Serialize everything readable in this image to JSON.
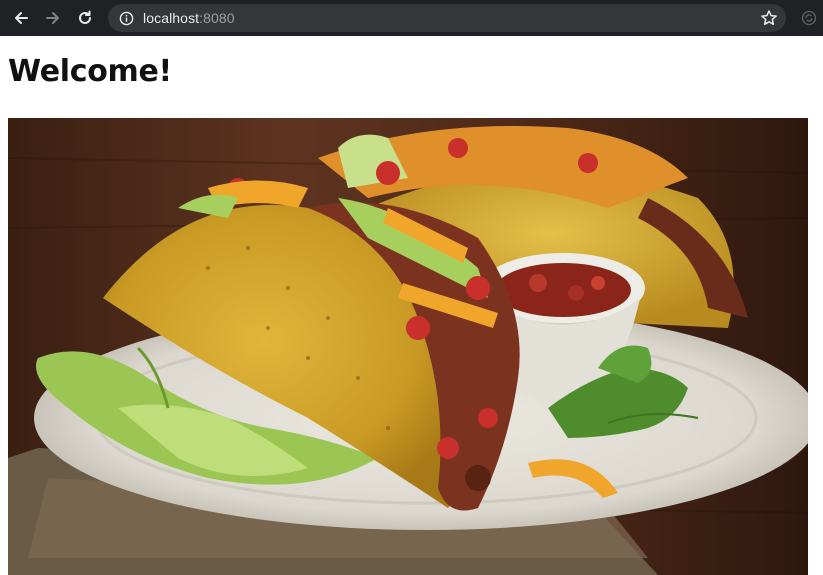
{
  "browser": {
    "url_host": "localhost",
    "url_port": ":8080",
    "icons": [
      "back-arrow-icon",
      "forward-arrow-icon",
      "reload-icon",
      "info-icon",
      "bookmark-star-icon",
      "extension-icon"
    ]
  },
  "page": {
    "heading": "Welcome!",
    "image": {
      "subject": "hard-shell-tacos-photo"
    }
  }
}
